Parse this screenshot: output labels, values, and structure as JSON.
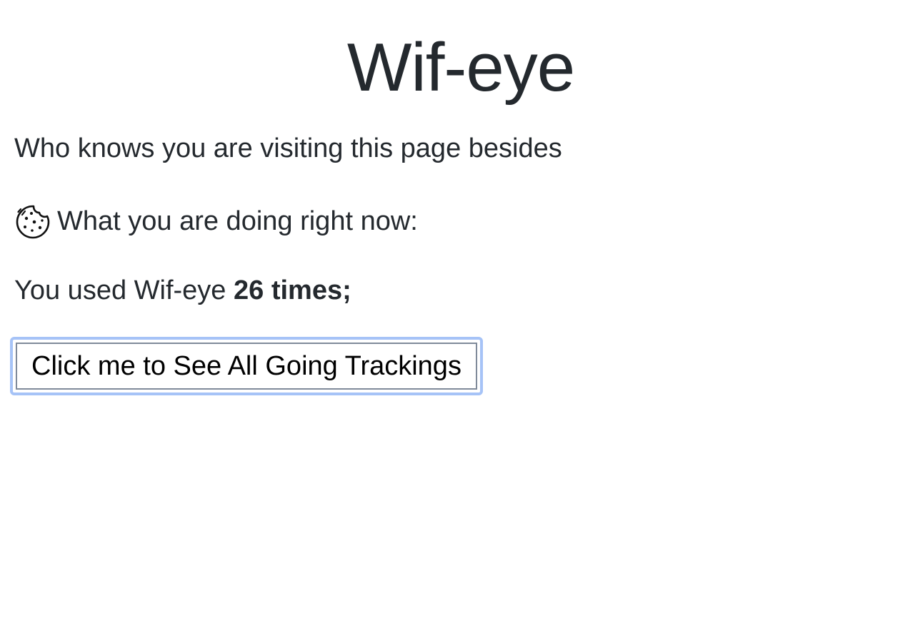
{
  "page": {
    "title": "Wif-eye",
    "subtitle": "Who knows you are visiting this page besides",
    "activity_label": "What you are doing right now:",
    "usage": {
      "prefix": "You used Wif-eye",
      "count_text": "26 times;"
    },
    "button_label": "Click me to See All Going Trackings"
  },
  "icons": {
    "cookie": "cookie-icon"
  },
  "colors": {
    "text": "#24292e",
    "focus_ring": "#a6c3f7",
    "button_border": "#7f8a9a"
  }
}
